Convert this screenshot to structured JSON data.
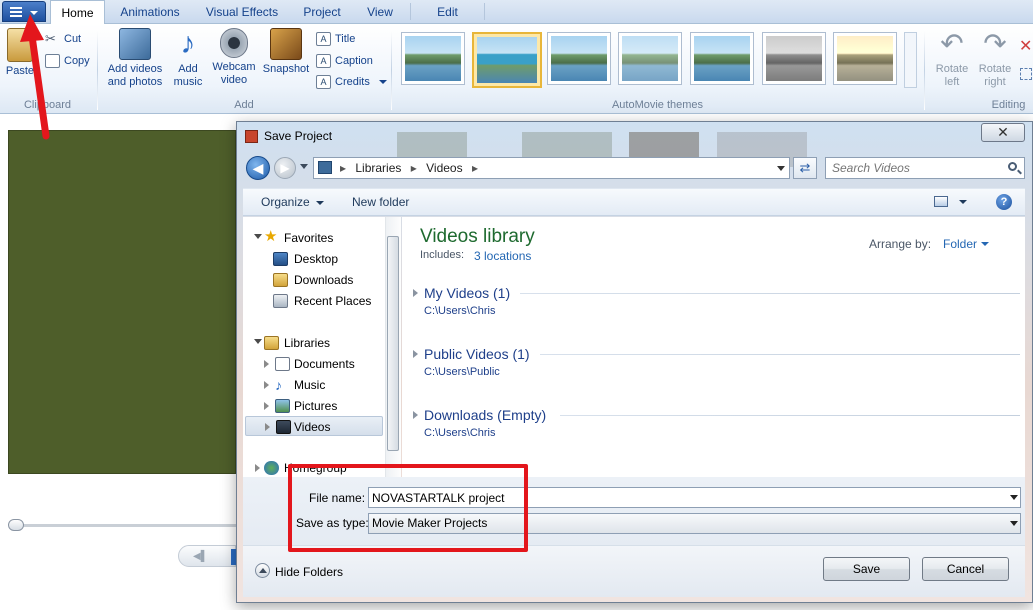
{
  "ribbon": {
    "tabs": [
      {
        "label": "Home",
        "active": true
      },
      {
        "label": "Animations"
      },
      {
        "label": "Visual Effects"
      },
      {
        "label": "Project"
      },
      {
        "label": "View"
      },
      {
        "label": "Edit"
      }
    ],
    "clipboard": {
      "paste": "Paste",
      "cut": "Cut",
      "copy": "Copy",
      "group_label": "Clipboard"
    },
    "add": {
      "add_videos": [
        "Add videos",
        "and photos"
      ],
      "add_music": [
        "Add",
        "music"
      ],
      "webcam": [
        "Webcam",
        "video"
      ],
      "snapshot": "Snapshot",
      "title": "Title",
      "caption": "Caption",
      "credits": "Credits",
      "group_label": "Add"
    },
    "themes": {
      "group_label": "AutoMovie themes",
      "selected_index": 1
    },
    "editing": {
      "rotate_left": [
        "Rotate",
        "left"
      ],
      "rotate_right": [
        "Rotate",
        "right"
      ],
      "group_label": "Editing"
    }
  },
  "dialog": {
    "title": "Save Project",
    "close_symbol": "✕",
    "breadcrumb": [
      "Libraries",
      "Videos"
    ],
    "search_placeholder": "Search Videos",
    "toolbar": {
      "organize": "Organize",
      "new_folder": "New folder"
    },
    "nav": {
      "favorites": "Favorites",
      "favorites_items": [
        "Desktop",
        "Downloads",
        "Recent Places"
      ],
      "libraries": "Libraries",
      "libraries_items": [
        "Documents",
        "Music",
        "Pictures",
        "Videos"
      ],
      "selected": "Videos",
      "homegroup": "Homegroup"
    },
    "library": {
      "title": "Videos library",
      "includes_label": "Includes:",
      "locations_link": "3 locations",
      "arrange_label": "Arrange by:",
      "arrange_value": "Folder",
      "groups": [
        {
          "title": "My Videos (1)",
          "path": "C:\\Users\\Chris"
        },
        {
          "title": "Public Videos (1)",
          "path": "C:\\Users\\Public"
        },
        {
          "title": "Downloads (Empty)",
          "path": "C:\\Users\\Chris"
        }
      ]
    },
    "file_name_label": "File name:",
    "file_name_value": "NOVASTARTALK project",
    "save_type_label": "Save as type:",
    "save_type_value": "Movie Maker Projects",
    "hide_folders": "Hide Folders",
    "save_button": "Save",
    "cancel_button": "Cancel"
  },
  "colors": {
    "annotation": "#e3161c",
    "library_title": "#1e6a2f",
    "link": "#2467b3",
    "preview": "#4e5e2a"
  }
}
